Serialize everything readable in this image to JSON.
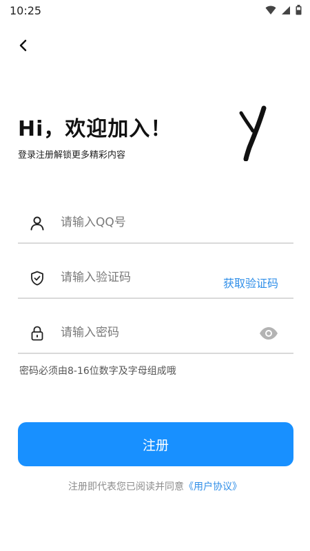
{
  "status_bar": {
    "time": "10:25",
    "icons": [
      "wifi-icon",
      "signal-icon",
      "battery-icon"
    ]
  },
  "header": {
    "back_icon": "chevron-left-icon"
  },
  "welcome": {
    "title": "Hi，欢迎加入！",
    "subtitle": "登录注册解锁更多精彩内容"
  },
  "form": {
    "qq": {
      "placeholder": "请输入QQ号",
      "value": "",
      "icon": "user-icon"
    },
    "code": {
      "placeholder": "请输入验证码",
      "value": "",
      "icon": "shield-icon",
      "action_label": "获取验证码"
    },
    "password": {
      "placeholder": "请输入密码",
      "value": "",
      "icon": "lock-icon",
      "toggle_icon": "eye-icon"
    },
    "hint": "密码必须由8-16位数字及字母组成哦"
  },
  "register": {
    "label": "注册"
  },
  "agreement": {
    "prefix": "注册即代表您已阅读并同意",
    "link": "《用户协议》"
  },
  "colors": {
    "accent": "#1890ff",
    "link": "#2f8ee8",
    "divider": "#d9d9d9"
  }
}
